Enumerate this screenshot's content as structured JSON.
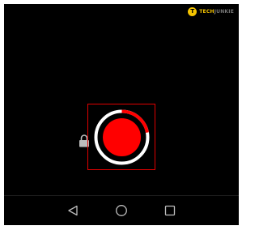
{
  "watermark": {
    "logo_letter": "T",
    "text_part1": "TECH",
    "text_part2": "JUNKIE"
  },
  "icons": {
    "lock": "lock-icon",
    "record": "record-button",
    "back": "back-triangle-icon",
    "home": "home-circle-icon",
    "recent": "recent-apps-square-icon"
  },
  "recording": {
    "progress_fraction": 0.22
  },
  "colors": {
    "background": "#000000",
    "record": "#ff0000",
    "ring": "#ffffff",
    "progress": "#ff0000",
    "frame": "#e00000",
    "nav_icons": "#bdbdbd"
  }
}
